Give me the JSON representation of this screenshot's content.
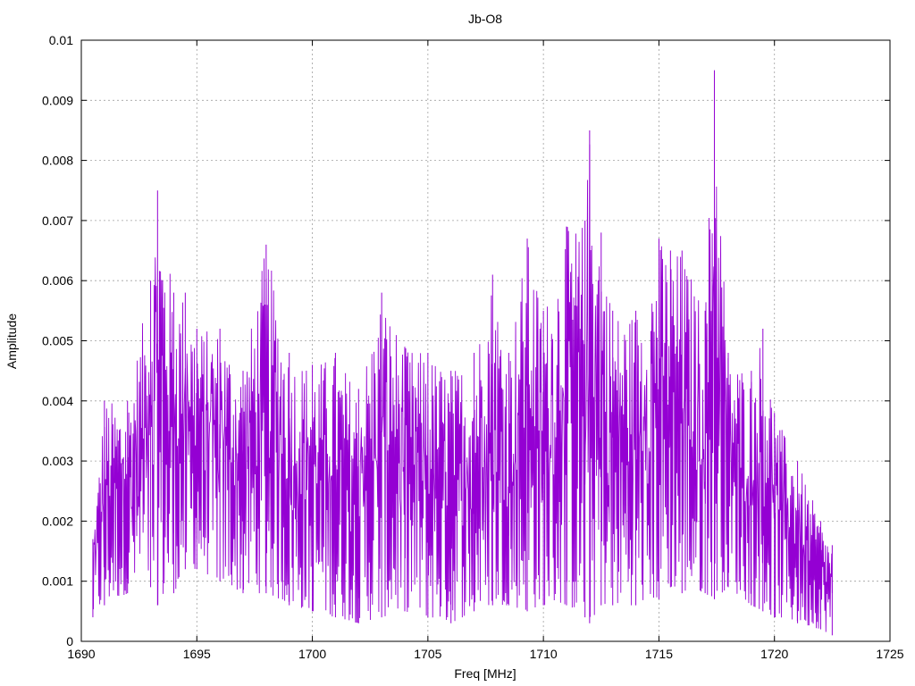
{
  "chart_data": {
    "type": "line",
    "title": "Jb-O8",
    "xlabel": "Freq [MHz]",
    "ylabel": "Amplitude",
    "xlim": [
      1690,
      1725
    ],
    "ylim": [
      0,
      0.01
    ],
    "x_ticks": [
      1690,
      1695,
      1700,
      1705,
      1710,
      1715,
      1720,
      1725
    ],
    "x_tick_labels": [
      "1690",
      "1695",
      "1700",
      "1705",
      "1710",
      "1715",
      "1720",
      "1725"
    ],
    "y_ticks": [
      0,
      0.001,
      0.002,
      0.003,
      0.004,
      0.005,
      0.006,
      0.007,
      0.008,
      0.009,
      0.01
    ],
    "y_tick_labels": [
      "0",
      "0.001",
      "0.002",
      "0.003",
      "0.004",
      "0.005",
      "0.006",
      "0.007",
      "0.008",
      "0.009",
      "0.01"
    ],
    "grid": true,
    "legend": "none",
    "series": [
      {
        "color": "#9400d3",
        "x_start": 1690.5,
        "x_end": 1722.5,
        "envelope_x": [
          1690.5,
          1691,
          1692,
          1693,
          1693.3,
          1694,
          1694.5,
          1695,
          1696,
          1697,
          1698,
          1699,
          1700,
          1701,
          1702,
          1703,
          1704,
          1705,
          1706,
          1707,
          1707.8,
          1708.5,
          1709.3,
          1710,
          1711,
          1711.8,
          1712,
          1712.5,
          1713,
          1714,
          1715,
          1715.5,
          1716,
          1717,
          1717.4,
          1718,
          1719,
          1719.5,
          1720,
          1721,
          1722,
          1722.5
        ],
        "envelope_low": [
          0.0004,
          0.0006,
          0.0008,
          0.0009,
          0.0006,
          0.0008,
          0.0012,
          0.0012,
          0.001,
          0.0008,
          0.0008,
          0.0006,
          0.0005,
          0.0004,
          0.0003,
          0.0004,
          0.0005,
          0.0004,
          0.0003,
          0.0005,
          0.0006,
          0.0006,
          0.0005,
          0.0006,
          0.0006,
          0.0004,
          0.0003,
          0.0006,
          0.0006,
          0.0006,
          0.0007,
          0.0009,
          0.0008,
          0.0008,
          0.0007,
          0.0009,
          0.0006,
          0.0005,
          0.0004,
          0.0003,
          0.0002,
          0.0001
        ],
        "envelope_high": [
          0.0017,
          0.004,
          0.004,
          0.006,
          0.0075,
          0.0058,
          0.0058,
          0.0052,
          0.0052,
          0.0045,
          0.0066,
          0.0048,
          0.0046,
          0.0048,
          0.0042,
          0.0058,
          0.0049,
          0.0048,
          0.0045,
          0.0048,
          0.0061,
          0.0048,
          0.0067,
          0.0055,
          0.0069,
          0.007,
          0.0085,
          0.0068,
          0.0055,
          0.0055,
          0.0067,
          0.0065,
          0.0065,
          0.0055,
          0.0095,
          0.0048,
          0.0045,
          0.0052,
          0.0038,
          0.003,
          0.002,
          0.0016
        ]
      }
    ]
  }
}
